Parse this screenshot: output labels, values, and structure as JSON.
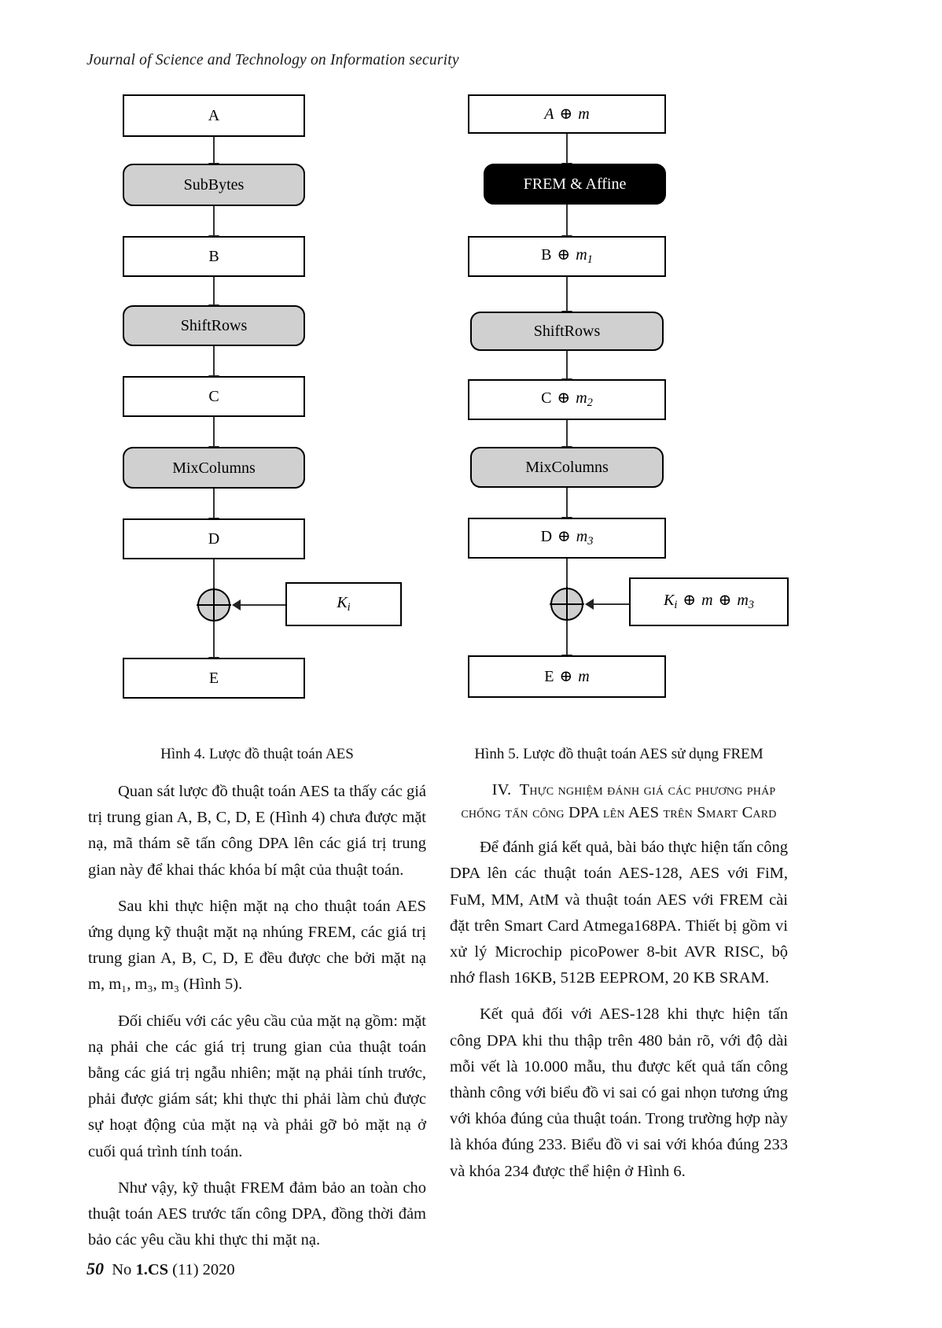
{
  "running_head": "Journal of Science and Technology on Information security",
  "figure_left": {
    "caption": "Hình 4. Lược đồ thuật toán AES",
    "nodes": [
      {
        "label": "A",
        "type": "rect"
      },
      {
        "label": "SubBytes",
        "type": "op"
      },
      {
        "label": "B",
        "type": "rect"
      },
      {
        "label": "ShiftRows",
        "type": "op"
      },
      {
        "label": "C",
        "type": "rect"
      },
      {
        "label": "MixColumns",
        "type": "op"
      },
      {
        "label": "D",
        "type": "rect"
      },
      {
        "label": "E",
        "type": "rect"
      }
    ],
    "key_box": "K i",
    "xor_symbol": "⊕"
  },
  "figure_right": {
    "caption": "Hình 5. Lược đồ thuật toán AES sử dụng FREM",
    "nodes": [
      {
        "label": "A ⊕ m",
        "type": "rect"
      },
      {
        "label": "FREM & Affine",
        "type": "black"
      },
      {
        "label": "B ⊕ m1",
        "type": "rect"
      },
      {
        "label": "ShiftRows",
        "type": "op"
      },
      {
        "label": "C ⊕ m2",
        "type": "rect"
      },
      {
        "label": "MixColumns",
        "type": "op"
      },
      {
        "label": "D ⊕ m3",
        "type": "rect"
      },
      {
        "label": "E ⊕ m",
        "type": "rect"
      }
    ],
    "key_box": "K i ⊕ m ⊕ m3",
    "xor_symbol": "⊕"
  },
  "left_column": {
    "paragraphs": [
      "Quan sát lược đồ thuật toán AES ta thấy các giá trị trung gian A, B, C, D, E (Hình 4) chưa được mặt nạ, mã thám sẽ tấn công DPA lên các giá trị trung gian này để khai thác khóa bí mật của thuật toán.",
      "Sau khi thực hiện mặt nạ cho thuật toán AES ứng dụng kỹ thuật mặt nạ nhúng FREM, các giá trị trung gian A, B, C, D, E đều được che bởi mặt nạ m, m₁, m₃, m₃ (Hình 5).",
      "Đối chiếu với các yêu cầu của mặt nạ gồm: mặt nạ phải che các giá trị trung gian của thuật toán bằng các giá trị ngẫu nhiên; mặt nạ phải tính trước, phải được giám sát; khi thực thi phải làm chủ được sự hoạt động của mặt nạ và phải gỡ bỏ mặt nạ ở cuối quá trình tính toán.",
      "Như vậy, kỹ thuật FREM đảm bảo an toàn cho thuật toán AES trước tấn công DPA, đồng thời đảm bảo các yêu cầu khi thực thi mặt nạ."
    ]
  },
  "right_column": {
    "section_number": "IV.",
    "section_title": "Thực nghiệm đánh giá các phương pháp chống tấn công DPA lên AES trên Smart Card",
    "paragraphs": [
      "Để đánh giá kết quả, bài báo thực hiện tấn công DPA lên các thuật toán AES-128, AES với FiM, FuM, MM, AtM và thuật toán AES với FREM cài đặt trên Smart Card Atmega168PA. Thiết bị gồm vi xử lý Microchip picoPower 8-bit AVR RISC, bộ nhớ flash 16KB, 512B EEPROM, 20 KB SRAM.",
      "Kết quả đối với AES-128 khi thực hiện tấn công DPA khi thu thập trên 480 bản rõ, với độ dài mỗi vết là 10.000 mẫu, thu được kết quả tấn công thành công với biểu đồ vi sai có gai nhọn tương ứng với khóa đúng của thuật toán. Trong trường hợp này là khóa đúng 233. Biểu đồ vi sai với khóa đúng 233 và khóa 234 được thể hiện ở Hình 6."
    ]
  },
  "footer": {
    "page_number": "50",
    "issue_prefix": "No ",
    "issue": "1.CS",
    "issue_suffix": " (11) 2020"
  }
}
